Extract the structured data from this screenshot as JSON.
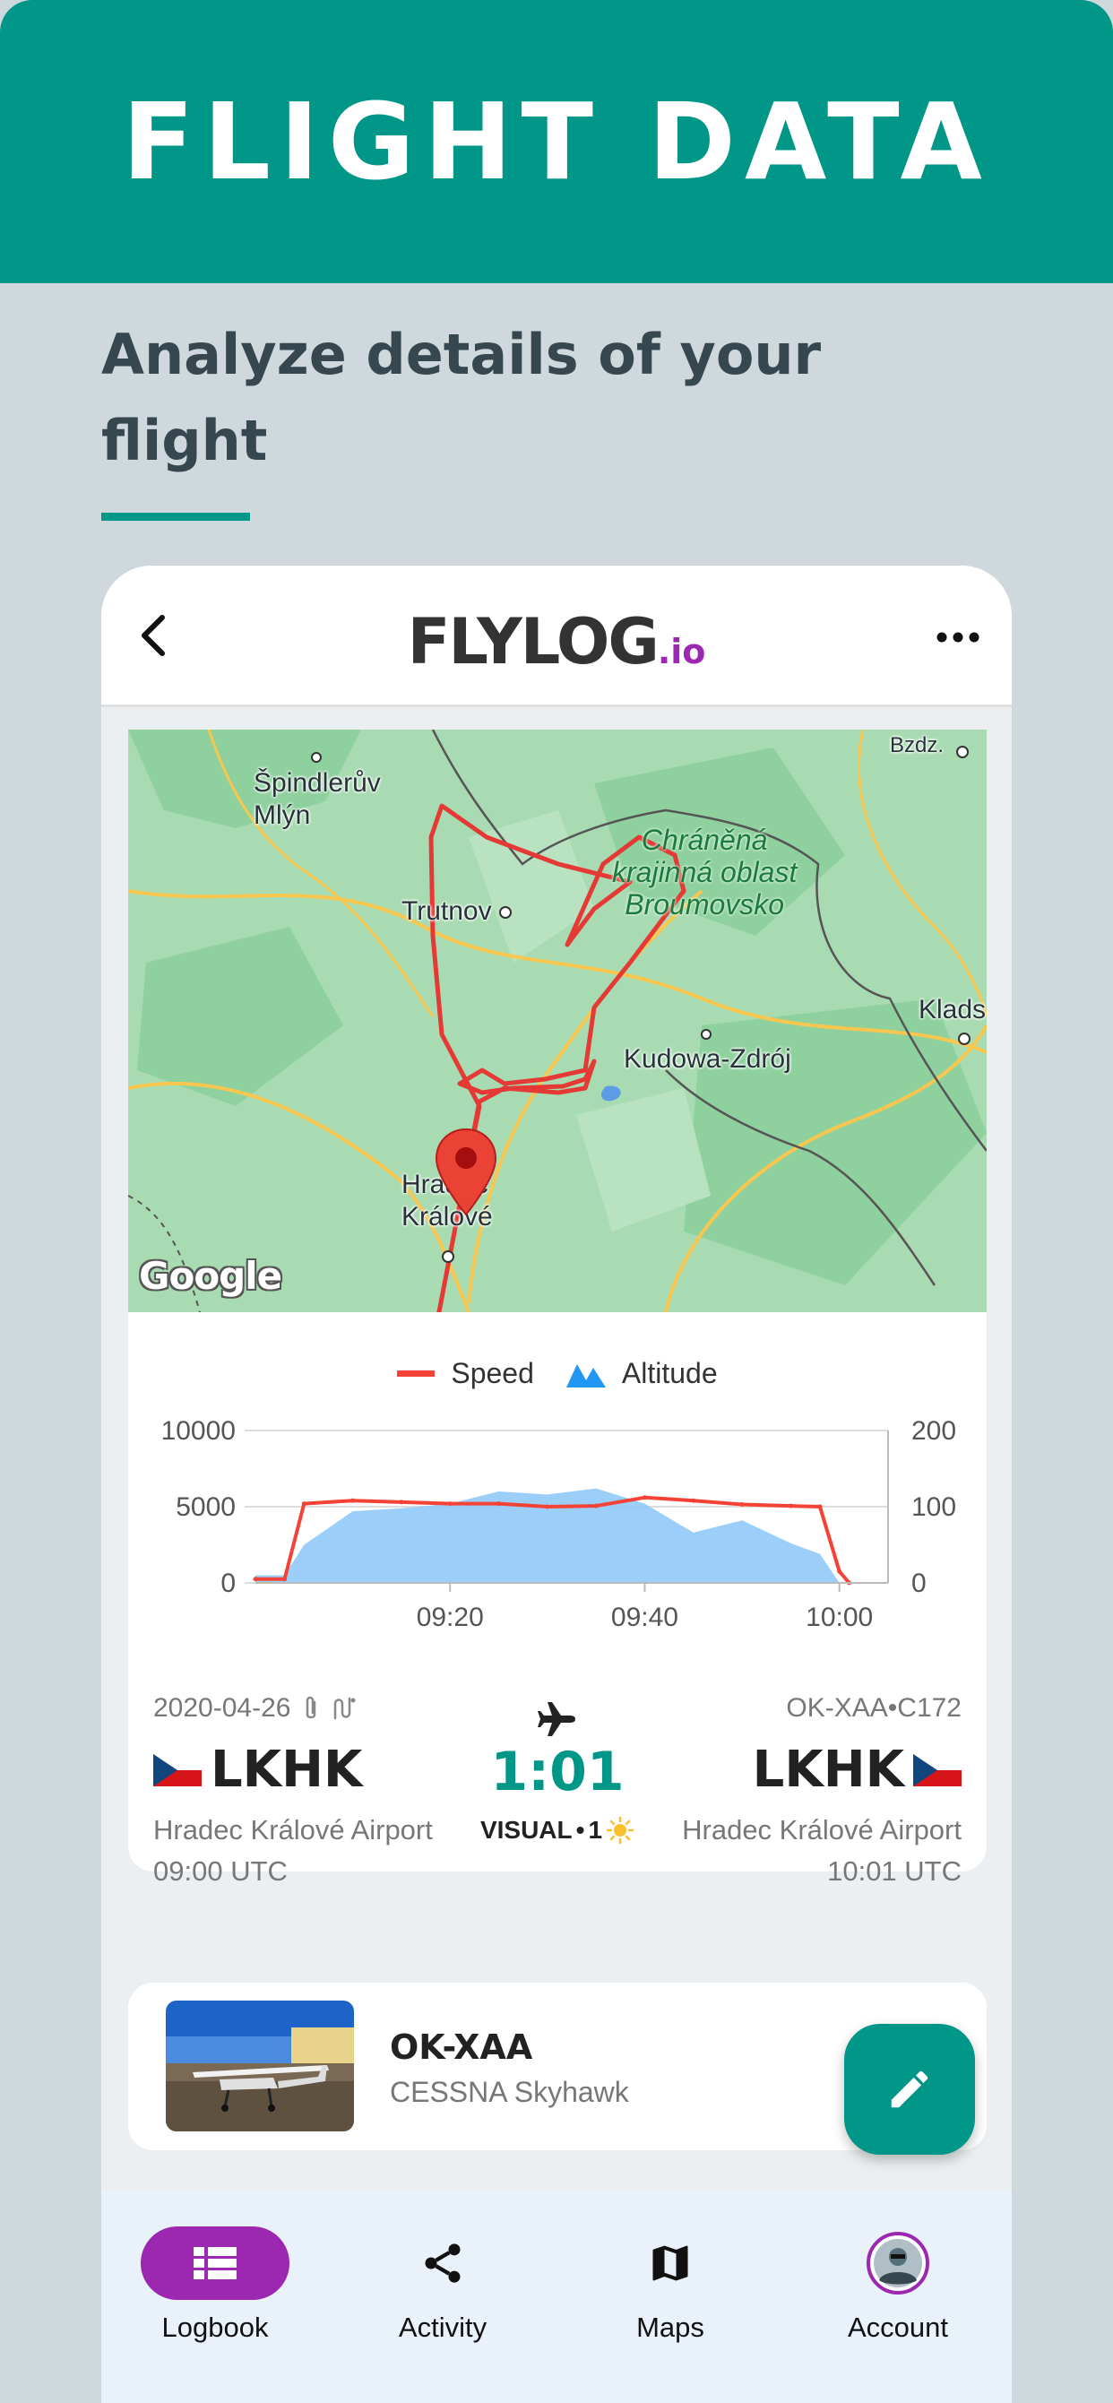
{
  "banner": {
    "title": "FLIGHT DATA"
  },
  "subtitle": "Analyze details of your flight",
  "appbar": {
    "logo_main": "FLYLOG",
    "logo_suffix": ".io"
  },
  "map": {
    "labels": {
      "spindleruv": "Špindlerův\nMlýn",
      "trutnov": "Trutnov",
      "park": "Chráněná\nkrajinná oblast\nBroumovsko",
      "klads": "Klads",
      "kudowa": "Kudowa-Zdrój",
      "hradec": "Hradec\nKrálové",
      "bzdz": "Bzdz."
    },
    "attribution": "Google"
  },
  "chart_data": {
    "type": "line",
    "legend": [
      "Speed",
      "Altitude"
    ],
    "x_ticks": [
      "09:20",
      "09:40",
      "10:00"
    ],
    "y_left_ticks": [
      "10000",
      "5000",
      "0"
    ],
    "y_right_ticks": [
      "200",
      "100",
      "0"
    ],
    "ylim_left": [
      0,
      10000
    ],
    "ylim_right": [
      0,
      200
    ],
    "x_minutes_after_0900": [
      0,
      3,
      5,
      10,
      15,
      20,
      25,
      30,
      35,
      40,
      45,
      50,
      55,
      58,
      60,
      61
    ],
    "series": [
      {
        "name": "Speed",
        "axis": "right",
        "values": [
          5,
          5,
          104,
          108,
          106,
          104,
          104,
          100,
          101,
          112,
          108,
          103,
          101,
          100,
          15,
          0
        ]
      },
      {
        "name": "Altitude",
        "axis": "left",
        "values": [
          500,
          500,
          2500,
          4700,
          4900,
          5200,
          6000,
          5800,
          6200,
          5200,
          3300,
          4100,
          2600,
          1900,
          0,
          0
        ]
      }
    ],
    "colors": {
      "Speed": "#f44336",
      "Altitude": "#90caf9"
    },
    "grid": true,
    "legend_position": "top-center"
  },
  "flight": {
    "date": "2020-04-26",
    "aircraft_type": "OK-XAA•C172",
    "departure_code": "LKHK",
    "arrival_code": "LKHK",
    "duration": "1:01",
    "conditions": "VISUAL",
    "landings": "1",
    "departure_name": "Hradec Králové Airport",
    "arrival_name": "Hradec Králové Airport",
    "departure_time": "09:00 UTC",
    "arrival_time": "10:01 UTC"
  },
  "aircraft": {
    "registration": "OK-XAA",
    "model": "CESSNA Skyhawk"
  },
  "nav": {
    "items": [
      {
        "label": "Logbook",
        "icon": "list-icon",
        "active": true
      },
      {
        "label": "Activity",
        "icon": "share-icon",
        "active": false
      },
      {
        "label": "Maps",
        "icon": "map-icon",
        "active": false
      },
      {
        "label": "Account",
        "icon": "avatar",
        "active": false
      }
    ]
  },
  "colors": {
    "accent": "#009688",
    "brand_purple": "#9c27b0",
    "background": "#cfd8dc",
    "route": "#e53935"
  }
}
